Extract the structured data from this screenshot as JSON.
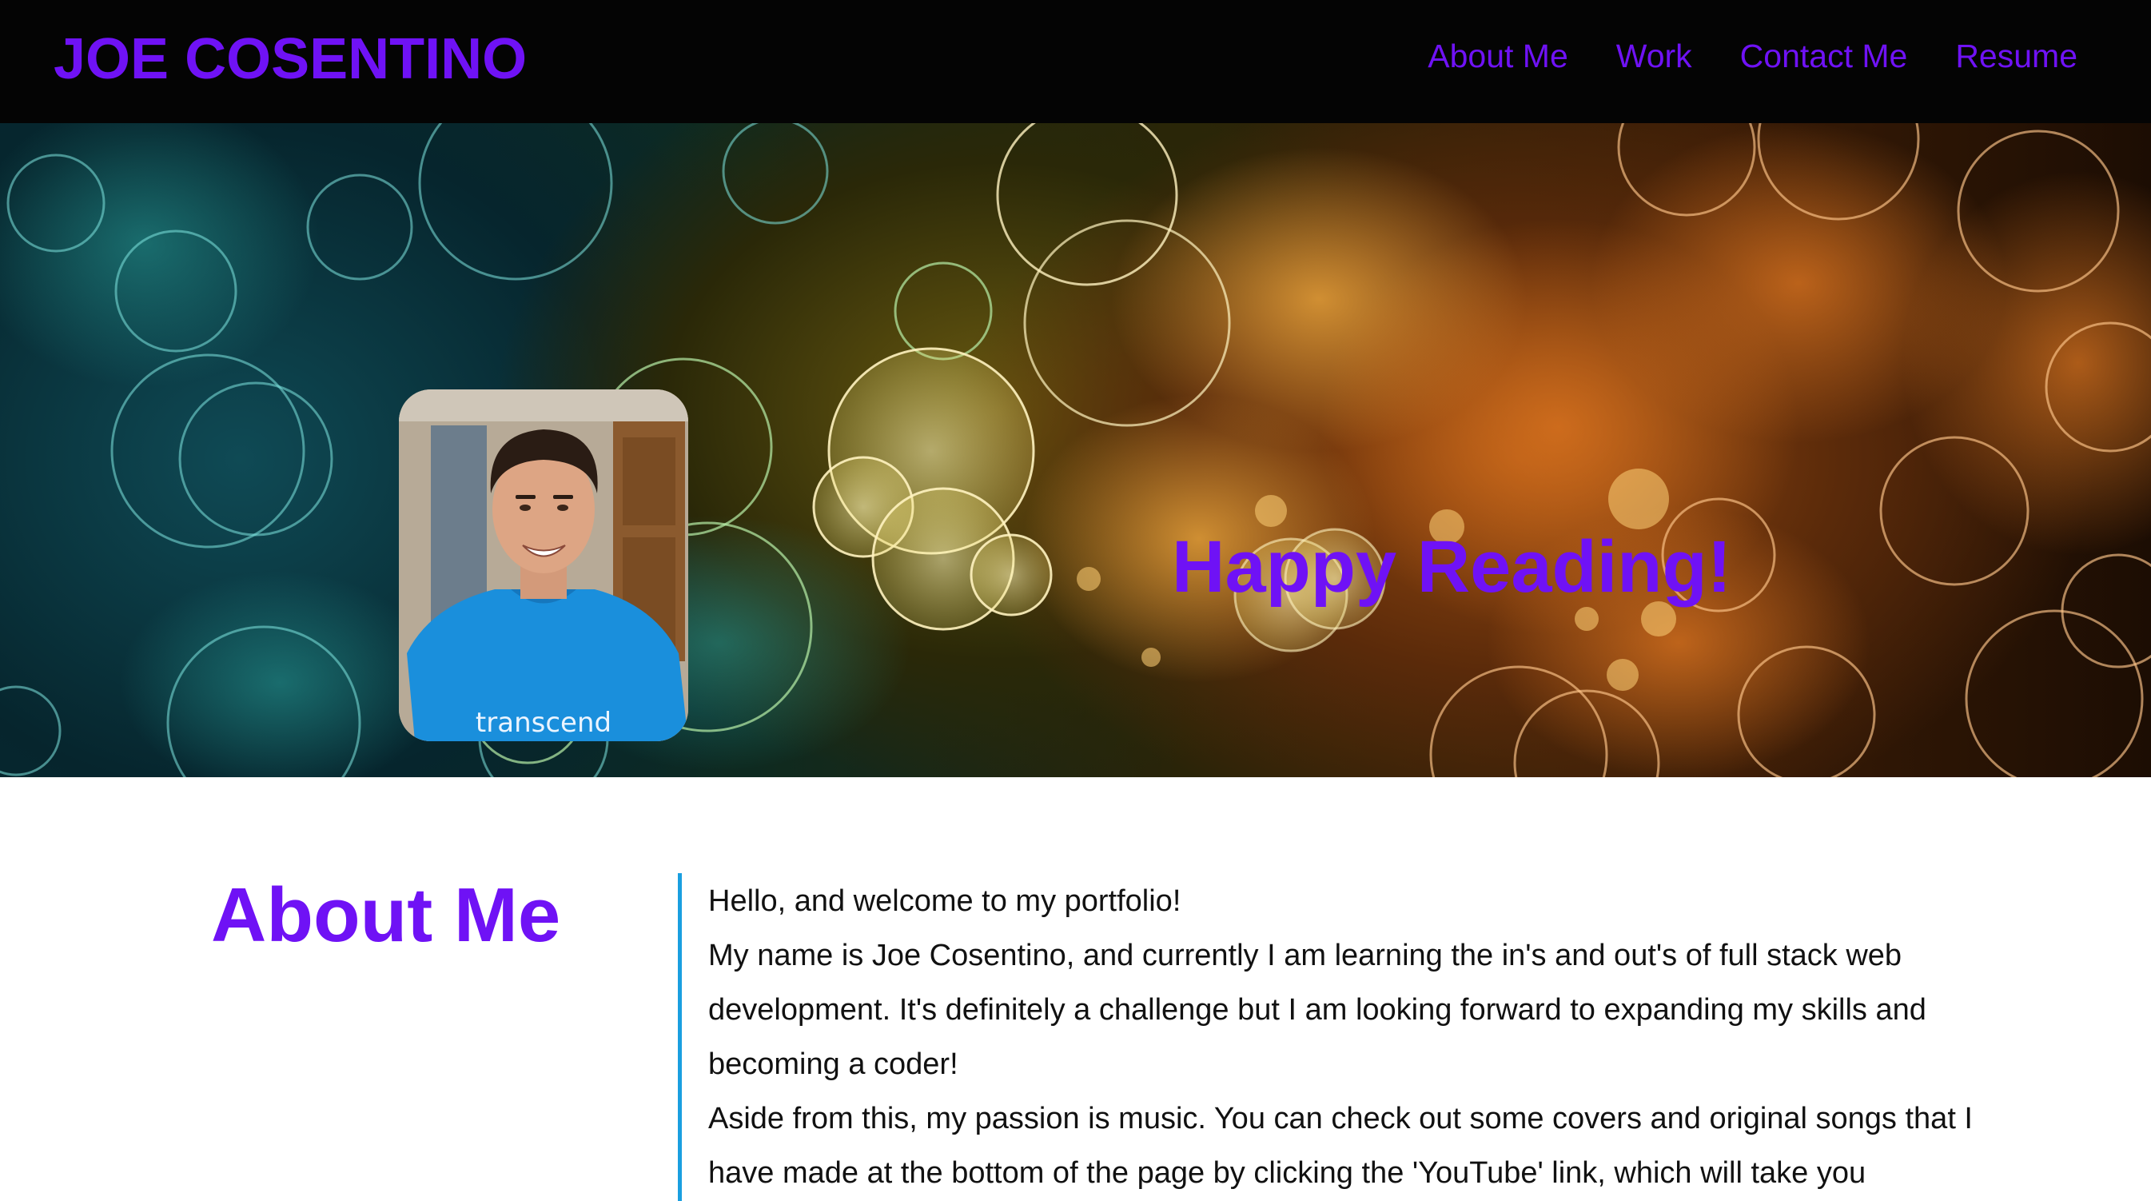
{
  "header": {
    "brand": "JOE COSENTINO",
    "nav": [
      {
        "label": "About Me"
      },
      {
        "label": "Work"
      },
      {
        "label": "Contact Me"
      },
      {
        "label": "Resume"
      }
    ]
  },
  "hero": {
    "tagline": "Happy Reading!",
    "shirt_text": "transcend"
  },
  "about": {
    "title": "About Me",
    "paragraphs": [
      "Hello, and welcome to my portfolio!",
      "My name is Joe Cosentino, and currently I am learning the in's and out's of full stack web development. It's definitely a challenge but I am looking forward to expanding my skills and becoming a coder!",
      "Aside from this, my passion is music. You can check out some covers and original songs that I have made at the bottom of the page by clicking the 'YouTube' link, which will take you"
    ]
  },
  "colors": {
    "accent": "#6f12f5",
    "header_bg": "#040404",
    "divider": "#1a9fe0"
  }
}
